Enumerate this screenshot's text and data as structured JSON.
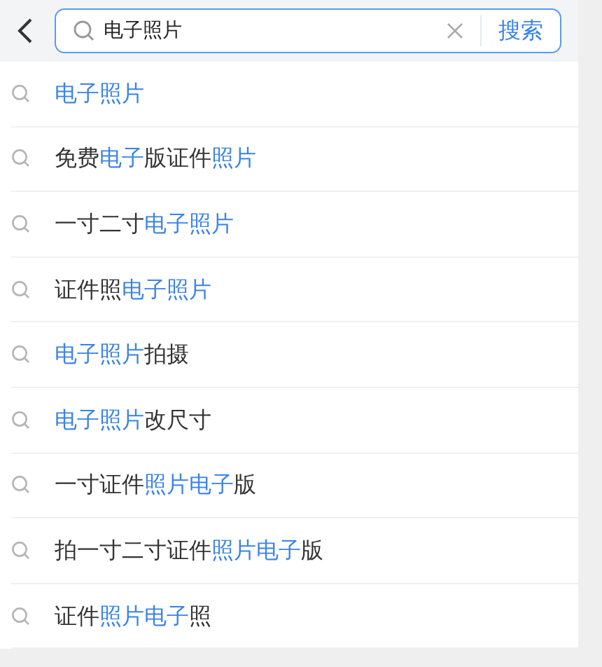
{
  "search": {
    "value": "电子照片",
    "button": "搜索"
  },
  "suggestions": [
    {
      "parts": [
        {
          "text": "电子照片",
          "highlight": true
        }
      ]
    },
    {
      "parts": [
        {
          "text": "免费",
          "highlight": false
        },
        {
          "text": "电子",
          "highlight": true
        },
        {
          "text": "版证件",
          "highlight": false
        },
        {
          "text": "照片",
          "highlight": true
        }
      ]
    },
    {
      "parts": [
        {
          "text": "一寸二寸",
          "highlight": false
        },
        {
          "text": "电子照片",
          "highlight": true
        }
      ]
    },
    {
      "parts": [
        {
          "text": "证件照",
          "highlight": false
        },
        {
          "text": "电子照片",
          "highlight": true
        }
      ]
    },
    {
      "parts": [
        {
          "text": "电子照片",
          "highlight": true
        },
        {
          "text": "拍摄",
          "highlight": false
        }
      ]
    },
    {
      "parts": [
        {
          "text": "电子照片",
          "highlight": true
        },
        {
          "text": "改尺寸",
          "highlight": false
        }
      ]
    },
    {
      "parts": [
        {
          "text": "一寸证件",
          "highlight": false
        },
        {
          "text": "照片电子",
          "highlight": true
        },
        {
          "text": "版",
          "highlight": false
        }
      ]
    },
    {
      "parts": [
        {
          "text": "拍一寸二寸证件",
          "highlight": false
        },
        {
          "text": "照片电子",
          "highlight": true
        },
        {
          "text": "版",
          "highlight": false
        }
      ]
    },
    {
      "parts": [
        {
          "text": "证件",
          "highlight": false
        },
        {
          "text": "照片电子",
          "highlight": true
        },
        {
          "text": "照",
          "highlight": false
        }
      ]
    }
  ]
}
